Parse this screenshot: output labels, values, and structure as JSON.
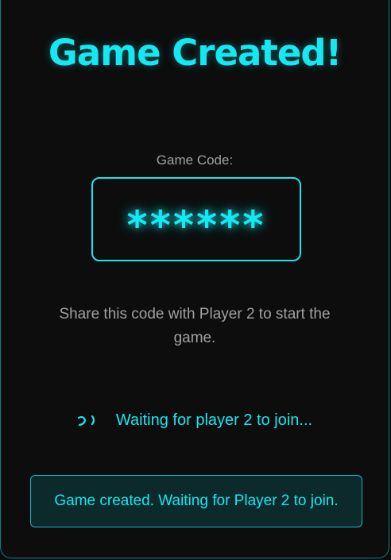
{
  "title": "Game Created!",
  "code_label": "Game Code:",
  "code_value": "******",
  "share_text": "Share this code with Player 2 to start the game.",
  "waiting": {
    "icon": "loading-spinner-icon",
    "text": "Waiting for player 2 to join..."
  },
  "status_message": "Game created. Waiting for Player 2 to join.",
  "colors": {
    "accent": "#14e8f2",
    "background": "#0d0d0d",
    "muted_text": "#a0a0a0",
    "status_background": "#0c2a2c"
  }
}
